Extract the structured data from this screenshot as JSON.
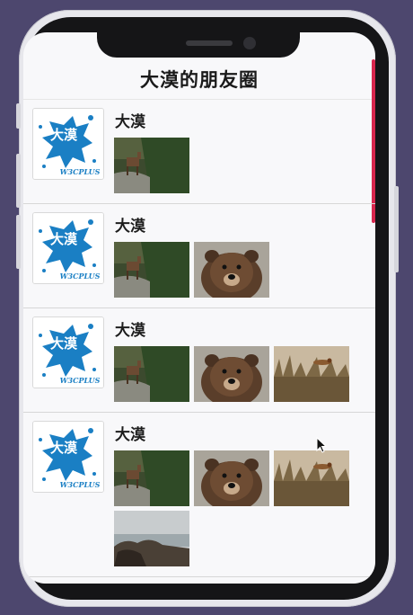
{
  "header": {
    "title": "大漠的朋友圈"
  },
  "posts": [
    {
      "author": "大漠",
      "avatar_text": "大漠",
      "avatar_sub": "W3CPLUS",
      "photos": [
        "deer"
      ]
    },
    {
      "author": "大漠",
      "avatar_text": "大漠",
      "avatar_sub": "W3CPLUS",
      "photos": [
        "deer",
        "bear"
      ]
    },
    {
      "author": "大漠",
      "avatar_text": "大漠",
      "avatar_sub": "W3CPLUS",
      "photos": [
        "deer",
        "bear",
        "bird"
      ]
    },
    {
      "author": "大漠",
      "avatar_text": "大漠",
      "avatar_sub": "W3CPLUS",
      "photos": [
        "deer",
        "bear",
        "bird",
        "coast"
      ]
    }
  ],
  "colors": {
    "background": "#4d476e",
    "accent_scrollbar": "#d8264d",
    "logo_blue": "#1a7fc4"
  }
}
